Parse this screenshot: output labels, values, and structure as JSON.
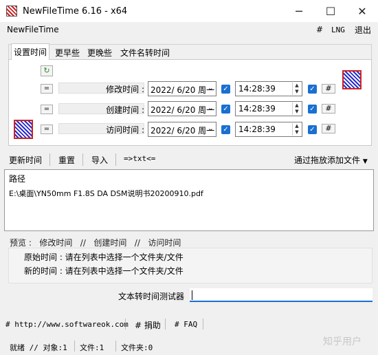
{
  "window": {
    "title": "NewFileTime 6.16 - x64",
    "min_glyph": "─",
    "max_glyph": "☐",
    "close_glyph": "✕"
  },
  "menubar": {
    "app_name": "NewFileTime",
    "hash": "#",
    "lng": "LNG",
    "exit": "退出"
  },
  "tabs": [
    {
      "label": "设置时间"
    },
    {
      "label": "更早些"
    },
    {
      "label": "更晚些"
    },
    {
      "label": "文件名转时间"
    }
  ],
  "rows": [
    {
      "eq": "=",
      "label": "修改时间 :",
      "date": "2022/ 6/20 周一",
      "time": "14:28:39",
      "hash": "#"
    },
    {
      "eq": "=",
      "label": "创建时间 :",
      "date": "2022/ 6/20 周一",
      "time": "14:28:39",
      "hash": "#"
    },
    {
      "eq": "=",
      "label": "访问时间 :",
      "date": "2022/ 6/20 周一",
      "time": "14:28:39",
      "hash": "#"
    }
  ],
  "toolbar": {
    "update": "更新时间",
    "reset": "重置",
    "import": "导入",
    "txt": "=>txt<=",
    "drag_add": "通过拖放添加文件"
  },
  "filelist": {
    "header": "路径",
    "rows": [
      "E:\\桌面\\YN50mm F1.8S DA DSM说明书20200910.pdf"
    ]
  },
  "preview": {
    "label": "预览 :",
    "tab_modified": "修改时间",
    "sep1": "//",
    "tab_created": "创建时间",
    "sep2": "//",
    "tab_accessed": "访问时间",
    "original": "原始时间 : 请在列表中选择一个文件夹/文件",
    "new": "新的时间 : 请在列表中选择一个文件夹/文件"
  },
  "tester": {
    "label": "文本转时间测试器",
    "value": ""
  },
  "links": {
    "site": "# http://www.softwareok.com",
    "donate": "# 捐助",
    "faq": "# FAQ"
  },
  "status": {
    "ready": "就绪 // 对象:1",
    "files": "文件:1",
    "folders": "文件夹:0"
  },
  "watermark": "知乎用户",
  "colors": {
    "accent": "#1a6fd1"
  }
}
